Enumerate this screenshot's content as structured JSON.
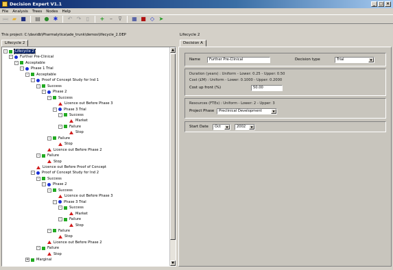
{
  "window": {
    "title": "Decision Expert  V1.1"
  },
  "menu": [
    "File",
    "Analysis",
    "Trees",
    "Nodes",
    "Help"
  ],
  "toolbar_icons": [
    "new-icon",
    "open-icon",
    "save-icon",
    "print-icon",
    "find-icon",
    "settings-icon",
    "undo-icon",
    "redo-icon",
    "paste-icon",
    "add-node-icon",
    "remove-node-icon",
    "filter-icon",
    "grid-icon",
    "chart-icon",
    "tree-icon",
    "run-icon"
  ],
  "project_path": "This project: C:\\davidb\\Pharmalytica\\ade_trunk\\demos\\lifecycle_2.DEP",
  "left": {
    "tab": "Lifecycle 2",
    "tree": [
      {
        "label": "Lifecycle 2",
        "icon": "square",
        "color": "#22aa22",
        "depth": 0,
        "exp": "-",
        "selected": true
      },
      {
        "label": "Further Pre-Clinical",
        "icon": "circle",
        "color": "#1a2fd6",
        "depth": 1,
        "exp": "-"
      },
      {
        "label": "Acceptable",
        "icon": "square",
        "color": "#22aa22",
        "depth": 2,
        "exp": "-"
      },
      {
        "label": "Phase 1 Trial",
        "icon": "circle",
        "color": "#1a2fd6",
        "depth": 3,
        "exp": "-"
      },
      {
        "label": "Acceptable",
        "icon": "square",
        "color": "#22aa22",
        "depth": 4,
        "exp": "-"
      },
      {
        "label": "Proof of Concept Study for Ind 1",
        "icon": "circle",
        "color": "#1a2fd6",
        "depth": 5,
        "exp": "-"
      },
      {
        "label": "Success",
        "icon": "square",
        "color": "#22aa22",
        "depth": 6,
        "exp": "-"
      },
      {
        "label": "Phase 2",
        "icon": "circle",
        "color": "#1a2fd6",
        "depth": 7,
        "exp": "-"
      },
      {
        "label": "Success",
        "icon": "square",
        "color": "#22aa22",
        "depth": 8,
        "exp": "-"
      },
      {
        "label": "Licence out Before Phase 3",
        "icon": "triangle",
        "color": "#d21c1c",
        "depth": 9,
        "exp": ""
      },
      {
        "label": "Phase 3 Trial",
        "icon": "circle",
        "color": "#1a2fd6",
        "depth": 9,
        "exp": "-"
      },
      {
        "label": "Success",
        "icon": "square",
        "color": "#22aa22",
        "depth": 10,
        "exp": "-"
      },
      {
        "label": "Market",
        "icon": "triangle",
        "color": "#d21c1c",
        "depth": 11,
        "exp": ""
      },
      {
        "label": "Failure",
        "icon": "square",
        "color": "#22aa22",
        "depth": 10,
        "exp": "-"
      },
      {
        "label": "Stop",
        "icon": "triangle",
        "color": "#d21c1c",
        "depth": 11,
        "exp": ""
      },
      {
        "label": "Failure",
        "icon": "square",
        "color": "#22aa22",
        "depth": 8,
        "exp": "-"
      },
      {
        "label": "Stop",
        "icon": "triangle",
        "color": "#d21c1c",
        "depth": 9,
        "exp": ""
      },
      {
        "label": "Licence out Before Phase 2",
        "icon": "triangle",
        "color": "#d21c1c",
        "depth": 7,
        "exp": ""
      },
      {
        "label": "Failure",
        "icon": "square",
        "color": "#22aa22",
        "depth": 6,
        "exp": "-"
      },
      {
        "label": "Stop",
        "icon": "triangle",
        "color": "#d21c1c",
        "depth": 7,
        "exp": ""
      },
      {
        "label": "Licence out Before Proof of Concept",
        "icon": "triangle",
        "color": "#d21c1c",
        "depth": 5,
        "exp": ""
      },
      {
        "label": "Proof of Concept Study for Ind 2",
        "icon": "circle",
        "color": "#1a2fd6",
        "depth": 5,
        "exp": "-"
      },
      {
        "label": "Success",
        "icon": "square",
        "color": "#22aa22",
        "depth": 6,
        "exp": "-"
      },
      {
        "label": "Phase 2",
        "icon": "circle",
        "color": "#1a2fd6",
        "depth": 7,
        "exp": "-"
      },
      {
        "label": "Success",
        "icon": "square",
        "color": "#22aa22",
        "depth": 8,
        "exp": "-"
      },
      {
        "label": "Licence out Before Phase 3",
        "icon": "triangle",
        "color": "#d21c1c",
        "depth": 9,
        "exp": ""
      },
      {
        "label": "Phase 3 Trial",
        "icon": "circle",
        "color": "#1a2fd6",
        "depth": 9,
        "exp": "-"
      },
      {
        "label": "Success",
        "icon": "square",
        "color": "#22aa22",
        "depth": 10,
        "exp": "-"
      },
      {
        "label": "Market",
        "icon": "triangle",
        "color": "#d21c1c",
        "depth": 11,
        "exp": ""
      },
      {
        "label": "Failure",
        "icon": "square",
        "color": "#22aa22",
        "depth": 10,
        "exp": "-"
      },
      {
        "label": "Stop",
        "icon": "triangle",
        "color": "#d21c1c",
        "depth": 11,
        "exp": ""
      },
      {
        "label": "Failure",
        "icon": "square",
        "color": "#22aa22",
        "depth": 8,
        "exp": "-"
      },
      {
        "label": "Stop",
        "icon": "triangle",
        "color": "#d21c1c",
        "depth": 9,
        "exp": ""
      },
      {
        "label": "Licence out Before Phase 2",
        "icon": "triangle",
        "color": "#d21c1c",
        "depth": 7,
        "exp": ""
      },
      {
        "label": "Failure",
        "icon": "square",
        "color": "#22aa22",
        "depth": 6,
        "exp": "-"
      },
      {
        "label": "Stop",
        "icon": "triangle",
        "color": "#d21c1c",
        "depth": 7,
        "exp": ""
      },
      {
        "label": "Marginal",
        "icon": "square",
        "color": "#22aa22",
        "depth": 4,
        "exp": "+"
      }
    ]
  },
  "right": {
    "title": "Lifecycle 2",
    "tab": "Decision A",
    "name_label": "Name",
    "name_value": "Further Pre-Clinical",
    "decision_type_label": "Decision type",
    "decision_type_value": "Trial",
    "duration": "Duration (years) : Uniform - Lower: 0.25 - Upper: 0.50",
    "cost": "Cost (£M) : Uniform - Lower: 0.1000 - Upper: 0.2000",
    "cost_upfront_label": "Cost up front (%)",
    "cost_upfront_value": "50.00",
    "resources": "Resources (FTEs) : Uniform - Lower: 2 - Upper: 3",
    "project_phase_label": "Project Phase",
    "project_phase_value": "Preclinical Development",
    "start_date_label": "Start Date",
    "start_month": "Oct",
    "start_year": "2002"
  }
}
